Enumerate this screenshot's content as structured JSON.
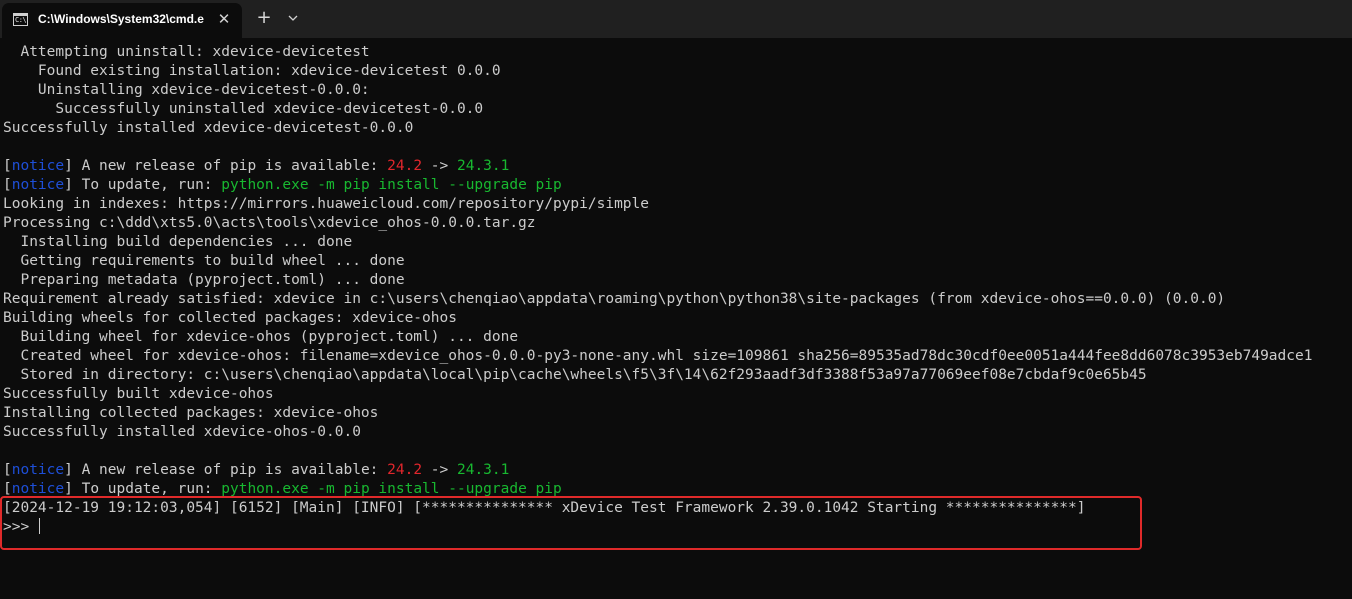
{
  "window": {
    "tab_title": "C:\\Windows\\System32\\cmd.e",
    "tab_icon_glyph": "C:\\",
    "close_glyph": "✕",
    "new_tab_glyph": "+"
  },
  "colors": {
    "background": "#0c0c0c",
    "titlebar": "#202020",
    "text": "#cccccc",
    "notice_blue": "#1e4fd8",
    "old_version_red": "#e0262c",
    "command_green": "#18b830",
    "highlight_red": "#e02a2a"
  },
  "terminal": {
    "lines": [
      "  Attempting uninstall: xdevice-devicetest",
      "    Found existing installation: xdevice-devicetest 0.0.0",
      "    Uninstalling xdevice-devicetest-0.0.0:",
      "      Successfully uninstalled xdevice-devicetest-0.0.0",
      "Successfully installed xdevice-devicetest-0.0.0",
      "",
      {
        "bracket_open": "[",
        "tag": "notice",
        "bracket_close": "]",
        "text": " A new release of pip is available: ",
        "old_version": "24.2",
        "arrow": " -> ",
        "new_version": "24.3.1"
      },
      {
        "bracket_open": "[",
        "tag": "notice",
        "bracket_close": "]",
        "text": " To update, run: ",
        "command": "python.exe -m pip install --upgrade pip"
      },
      "Looking in indexes: https://mirrors.huaweicloud.com/repository/pypi/simple",
      "Processing c:\\ddd\\xts5.0\\acts\\tools\\xdevice_ohos-0.0.0.tar.gz",
      "  Installing build dependencies ... done",
      "  Getting requirements to build wheel ... done",
      "  Preparing metadata (pyproject.toml) ... done",
      "Requirement already satisfied: xdevice in c:\\users\\chenqiao\\appdata\\roaming\\python\\python38\\site-packages (from xdevice-ohos==0.0.0) (0.0.0)",
      "Building wheels for collected packages: xdevice-ohos",
      "  Building wheel for xdevice-ohos (pyproject.toml) ... done",
      "  Created wheel for xdevice-ohos: filename=xdevice_ohos-0.0.0-py3-none-any.whl size=109861 sha256=89535ad78dc30cdf0ee0051a444fee8dd6078c3953eb749adce1",
      "  Stored in directory: c:\\users\\chenqiao\\appdata\\local\\pip\\cache\\wheels\\f5\\3f\\14\\62f293aadf3df3388f53a97a77069eef08e7cbdaf9c0e65b45",
      "Successfully built xdevice-ohos",
      "Installing collected packages: xdevice-ohos",
      "Successfully installed xdevice-ohos-0.0.0",
      "",
      {
        "bracket_open": "[",
        "tag": "notice",
        "bracket_close": "]",
        "text": " A new release of pip is available: ",
        "old_version": "24.2",
        "arrow": " -> ",
        "new_version": "24.3.1"
      },
      {
        "bracket_open": "[",
        "tag": "notice",
        "bracket_close": "]",
        "text": " To update, run: ",
        "command": "python.exe -m pip install --upgrade pip"
      },
      "[2024-12-19 19:12:03,054] [6152] [Main] [INFO] [*************** xDevice Test Framework 2.39.0.1042 Starting ***************]"
    ],
    "prompt": ">>> "
  }
}
